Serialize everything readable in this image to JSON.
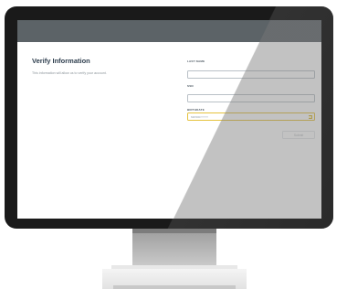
{
  "page": {
    "title": "Verify Information",
    "subtitle": "This information will allow us to verify your account."
  },
  "form": {
    "fields": [
      {
        "label": "LAST NAME",
        "value": "",
        "placeholder": ""
      },
      {
        "label": "SSN",
        "value": "",
        "placeholder": ""
      },
      {
        "label": "BIRTHDATE",
        "value": "",
        "placeholder": "MM/DD/YYYY",
        "icon": "calendar-icon"
      }
    ],
    "submit_label": "Submit"
  },
  "colors": {
    "topbar": "#5c6367",
    "title": "#2d3d4d",
    "date_accent": "#e5c23d"
  }
}
